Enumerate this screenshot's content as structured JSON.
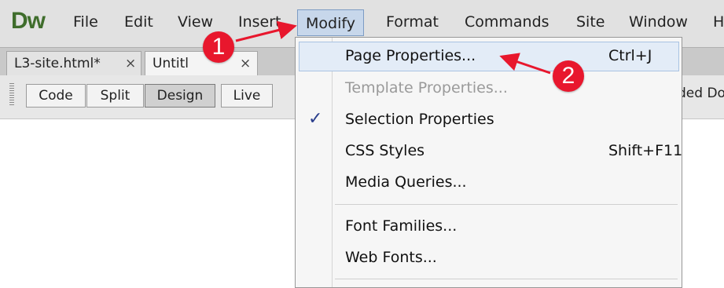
{
  "app": {
    "logo": "Dw"
  },
  "menubar": {
    "items": [
      "File",
      "Edit",
      "View",
      "Insert",
      "Modify",
      "Format",
      "Commands",
      "Site",
      "Window",
      "H"
    ],
    "active": "Modify"
  },
  "tabs": [
    {
      "label": "L3-site.html*",
      "close": "×"
    },
    {
      "label": "Untitl",
      "close": "×"
    }
  ],
  "toolbar": {
    "buttons": [
      "Code",
      "Split",
      "Design",
      "Live"
    ],
    "selected": "Design",
    "doc_title_fragment": "ded Do"
  },
  "modify_menu": {
    "items": [
      {
        "label": "Page Properties...",
        "shortcut": "Ctrl+J"
      },
      {
        "label": "Template Properties...",
        "shortcut": ""
      },
      {
        "label": "Selection Properties",
        "shortcut": "",
        "check": "✓"
      },
      {
        "label": "CSS Styles",
        "shortcut": "Shift+F11"
      },
      {
        "label": "Media Queries...",
        "shortcut": ""
      },
      {
        "label": "Font Families...",
        "shortcut": ""
      },
      {
        "label": "Web Fonts...",
        "shortcut": ""
      }
    ]
  },
  "callouts": [
    "1",
    "2"
  ],
  "colors": {
    "callout": "#e8172d",
    "logo": "#3f6d2c",
    "menu_highlight": "#c7d7eb",
    "item_hover": "#e3ecf7"
  }
}
